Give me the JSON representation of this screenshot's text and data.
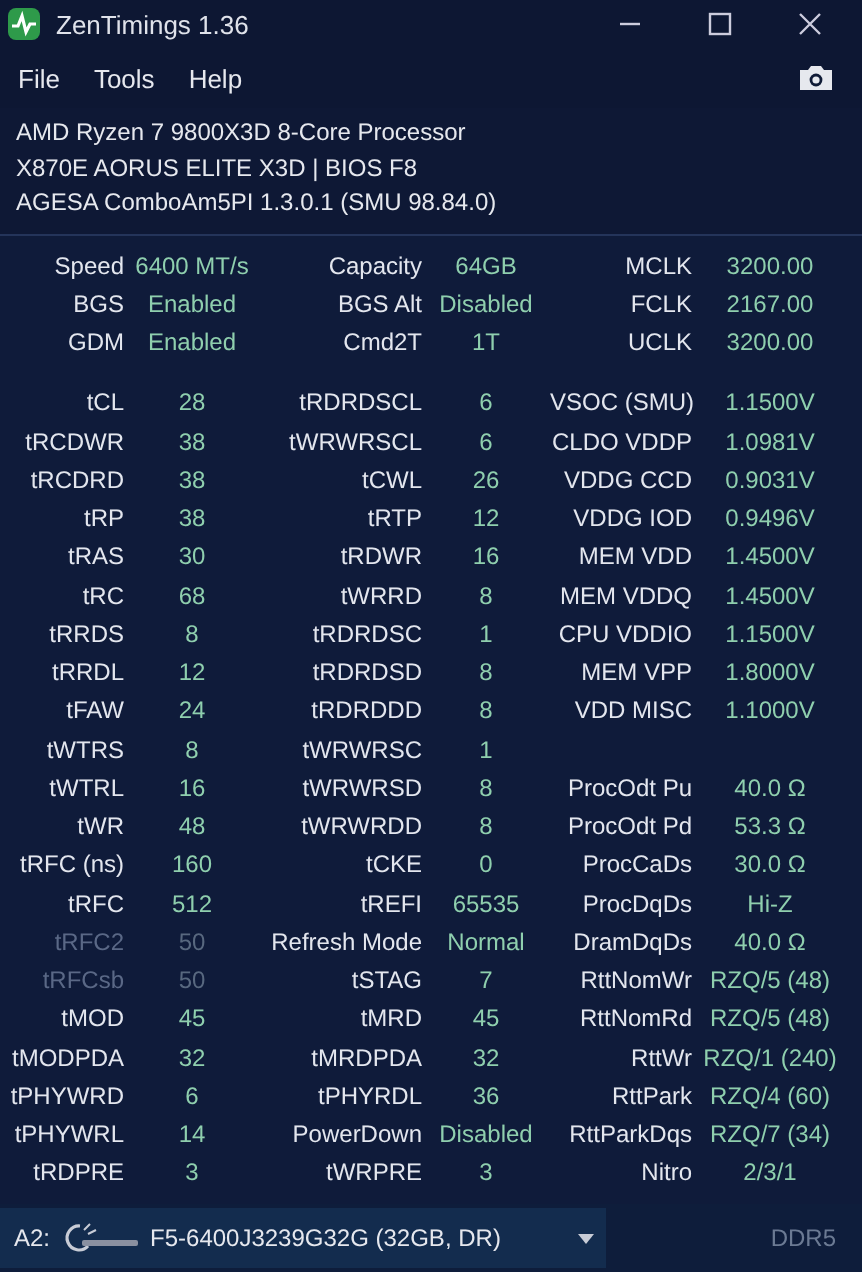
{
  "window": {
    "title": "ZenTimings 1.36"
  },
  "menu": [
    "File",
    "Tools",
    "Help"
  ],
  "system_info": [
    "AMD Ryzen 7 9800X3D 8-Core Processor",
    "X870E AORUS ELITE X3D | BIOS F8",
    "AGESA ComboAm5PI 1.3.0.1 (SMU 98.84.0)"
  ],
  "summary_rows": [
    {
      "cells": [
        {
          "label": "Speed",
          "value": "6400 MT/s",
          "disabled": false
        },
        {
          "label": "Capacity",
          "value": "64GB",
          "disabled": false
        },
        {
          "label": "MCLK",
          "value": "3200.00",
          "disabled": false
        }
      ]
    },
    {
      "cells": [
        {
          "label": "BGS",
          "value": "Enabled",
          "disabled": false
        },
        {
          "label": "BGS Alt",
          "value": "Disabled",
          "disabled": false
        },
        {
          "label": "FCLK",
          "value": "2167.00",
          "disabled": false
        }
      ]
    },
    {
      "cells": [
        {
          "label": "GDM",
          "value": "Enabled",
          "disabled": false
        },
        {
          "label": "Cmd2T",
          "value": "1T",
          "disabled": false
        },
        {
          "label": "UCLK",
          "value": "3200.00",
          "disabled": false
        }
      ]
    }
  ],
  "timing_rows": [
    {
      "cells": [
        {
          "label": "tCL",
          "value": "28",
          "disabled": false
        },
        {
          "label": "tRDRDSCL",
          "value": "6",
          "disabled": false
        },
        {
          "label": "VSOC (SMU)",
          "value": "1.1500V",
          "disabled": false
        }
      ]
    },
    {
      "cells": [
        {
          "label": "tRCDWR",
          "value": "38",
          "disabled": false
        },
        {
          "label": "tWRWRSCL",
          "value": "6",
          "disabled": false
        },
        {
          "label": "CLDO VDDP",
          "value": "1.0981V",
          "disabled": false
        }
      ]
    },
    {
      "cells": [
        {
          "label": "tRCDRD",
          "value": "38",
          "disabled": false
        },
        {
          "label": "tCWL",
          "value": "26",
          "disabled": false
        },
        {
          "label": "VDDG CCD",
          "value": "0.9031V",
          "disabled": false
        }
      ]
    },
    {
      "cells": [
        {
          "label": "tRP",
          "value": "38",
          "disabled": false
        },
        {
          "label": "tRTP",
          "value": "12",
          "disabled": false
        },
        {
          "label": "VDDG IOD",
          "value": "0.9496V",
          "disabled": false
        }
      ]
    },
    {
      "cells": [
        {
          "label": "tRAS",
          "value": "30",
          "disabled": false
        },
        {
          "label": "tRDWR",
          "value": "16",
          "disabled": false
        },
        {
          "label": "MEM VDD",
          "value": "1.4500V",
          "disabled": false
        }
      ]
    },
    {
      "cells": [
        {
          "label": "tRC",
          "value": "68",
          "disabled": false
        },
        {
          "label": "tWRRD",
          "value": "8",
          "disabled": false
        },
        {
          "label": "MEM VDDQ",
          "value": "1.4500V",
          "disabled": false
        }
      ]
    },
    {
      "cells": [
        {
          "label": "tRRDS",
          "value": "8",
          "disabled": false
        },
        {
          "label": "tRDRDSC",
          "value": "1",
          "disabled": false
        },
        {
          "label": "CPU VDDIO",
          "value": "1.1500V",
          "disabled": false
        }
      ]
    },
    {
      "cells": [
        {
          "label": "tRRDL",
          "value": "12",
          "disabled": false
        },
        {
          "label": "tRDRDSD",
          "value": "8",
          "disabled": false
        },
        {
          "label": "MEM VPP",
          "value": "1.8000V",
          "disabled": false
        }
      ]
    },
    {
      "cells": [
        {
          "label": "tFAW",
          "value": "24",
          "disabled": false
        },
        {
          "label": "tRDRDDD",
          "value": "8",
          "disabled": false
        },
        {
          "label": "VDD MISC",
          "value": "1.1000V",
          "disabled": false
        }
      ]
    },
    {
      "cells": [
        {
          "label": "tWTRS",
          "value": "8",
          "disabled": false
        },
        {
          "label": "tWRWRSC",
          "value": "1",
          "disabled": false
        }
      ]
    },
    {
      "cells": [
        {
          "label": "tWTRL",
          "value": "16",
          "disabled": false
        },
        {
          "label": "tWRWRSD",
          "value": "8",
          "disabled": false
        },
        {
          "label": "ProcOdt Pu",
          "value": "40.0 Ω",
          "disabled": false
        }
      ]
    },
    {
      "cells": [
        {
          "label": "tWR",
          "value": "48",
          "disabled": false
        },
        {
          "label": "tWRWRDD",
          "value": "8",
          "disabled": false
        },
        {
          "label": "ProcOdt Pd",
          "value": "53.3 Ω",
          "disabled": false
        }
      ]
    },
    {
      "cells": [
        {
          "label": "tRFC (ns)",
          "value": "160",
          "disabled": false
        },
        {
          "label": "tCKE",
          "value": "0",
          "disabled": false
        },
        {
          "label": "ProcCaDs",
          "value": "30.0 Ω",
          "disabled": false
        }
      ]
    },
    {
      "cells": [
        {
          "label": "tRFC",
          "value": "512",
          "disabled": false
        },
        {
          "label": "tREFI",
          "value": "65535",
          "disabled": false
        },
        {
          "label": "ProcDqDs",
          "value": "Hi-Z",
          "disabled": false
        }
      ]
    },
    {
      "cells": [
        {
          "label": "tRFC2",
          "value": "50",
          "disabled": true
        },
        {
          "label": "Refresh Mode",
          "value": "Normal",
          "disabled": false
        },
        {
          "label": "DramDqDs",
          "value": "40.0 Ω",
          "disabled": false
        }
      ]
    },
    {
      "cells": [
        {
          "label": "tRFCsb",
          "value": "50",
          "disabled": true
        },
        {
          "label": "tSTAG",
          "value": "7",
          "disabled": false
        },
        {
          "label": "RttNomWr",
          "value": "RZQ/5 (48)",
          "disabled": false
        }
      ]
    },
    {
      "cells": [
        {
          "label": "tMOD",
          "value": "45",
          "disabled": false
        },
        {
          "label": "tMRD",
          "value": "45",
          "disabled": false
        },
        {
          "label": "RttNomRd",
          "value": "RZQ/5 (48)",
          "disabled": false
        }
      ]
    },
    {
      "cells": [
        {
          "label": "tMODPDA",
          "value": "32",
          "disabled": false
        },
        {
          "label": "tMRDPDA",
          "value": "32",
          "disabled": false
        },
        {
          "label": "RttWr",
          "value": "RZQ/1 (240)",
          "disabled": false
        }
      ]
    },
    {
      "cells": [
        {
          "label": "tPHYWRD",
          "value": "6",
          "disabled": false
        },
        {
          "label": "tPHYRDL",
          "value": "36",
          "disabled": false
        },
        {
          "label": "RttPark",
          "value": "RZQ/4 (60)",
          "disabled": false
        }
      ]
    },
    {
      "cells": [
        {
          "label": "tPHYWRL",
          "value": "14",
          "disabled": false
        },
        {
          "label": "PowerDown",
          "value": "Disabled",
          "disabled": false
        },
        {
          "label": "RttParkDqs",
          "value": "RZQ/7 (34)",
          "disabled": false
        }
      ]
    },
    {
      "cells": [
        {
          "label": "tRDPRE",
          "value": "3",
          "disabled": false
        },
        {
          "label": "tWRPRE",
          "value": "3",
          "disabled": false
        },
        {
          "label": "Nitro",
          "value": "2/3/1",
          "disabled": false
        }
      ]
    }
  ],
  "status_bar": {
    "slot_label": "A2:",
    "module": "F5-6400J3239G32G (32GB, DR)",
    "memory_type": "DDR5"
  }
}
